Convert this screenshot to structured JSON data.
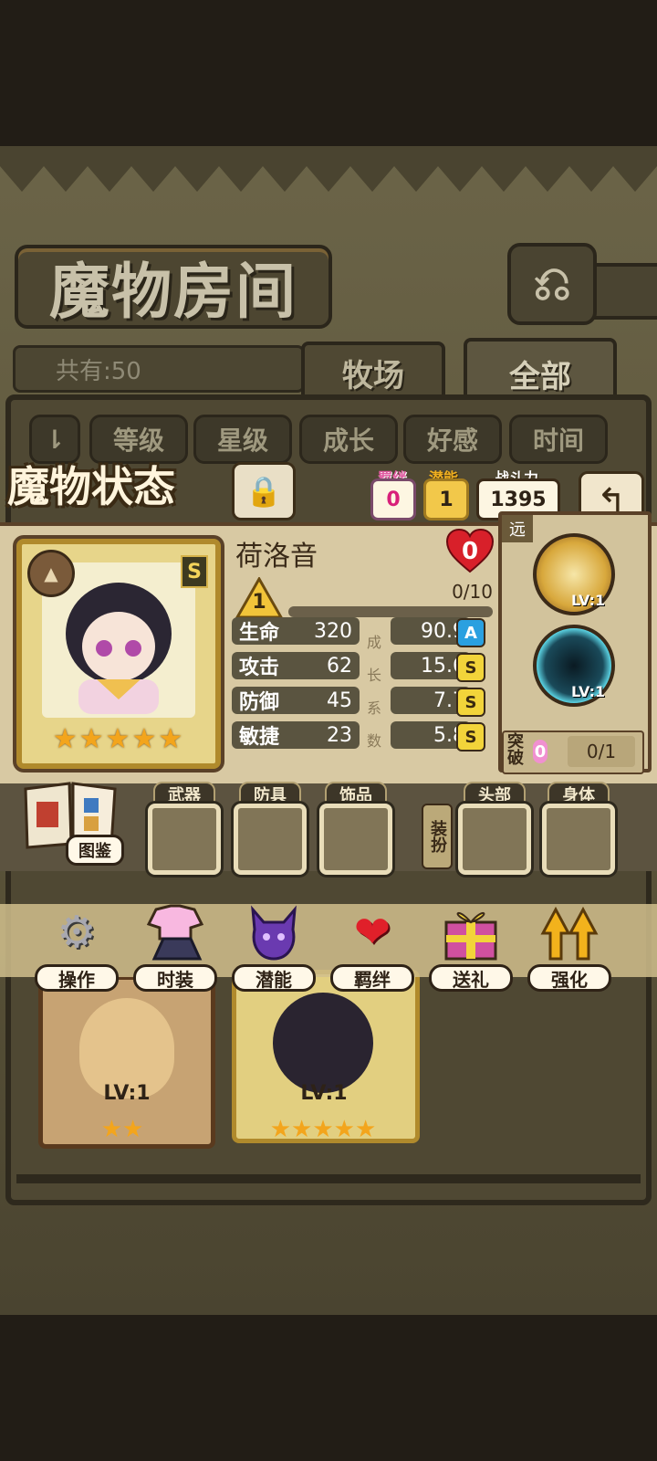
{
  "header": {
    "title": "魔物房间",
    "back_icon": "return-arrow-icon"
  },
  "inventory": {
    "count_label": "共有:50"
  },
  "tabs": [
    {
      "label": "牧场"
    },
    {
      "label": "全部"
    }
  ],
  "sort_buttons": [
    "等级",
    "星级",
    "成长",
    "好感",
    "时间"
  ],
  "status": {
    "title": "魔物状态",
    "bond_label": "羁绊",
    "bond_value": "0",
    "potential_label": "潜能",
    "potential_value": "1",
    "power_label": "战斗力",
    "power_value": "1395"
  },
  "monster": {
    "name": "荷洛音",
    "rank": "S",
    "stars": 5,
    "affection": "0",
    "level": "1",
    "exp_text": "0/10",
    "exp_fraction": 0.0,
    "stats": [
      {
        "name": "生命",
        "value": "320",
        "growth": "90.9",
        "grade": "A"
      },
      {
        "name": "攻击",
        "value": "62",
        "growth": "15.6",
        "grade": "S"
      },
      {
        "name": "防御",
        "value": "45",
        "growth": "7.7",
        "grade": "S"
      },
      {
        "name": "敏捷",
        "value": "23",
        "growth": "5.8",
        "grade": "S"
      }
    ],
    "growth_chars": [
      "成",
      "长",
      "系",
      "数"
    ]
  },
  "skills": {
    "range_tag": "远",
    "items": [
      {
        "lv": "LV:1"
      },
      {
        "lv": "LV:1"
      }
    ],
    "break_label": "突破",
    "break_count": "0",
    "break_progress": "0/1"
  },
  "equipment": {
    "book_label": "图鉴",
    "slots": [
      "武器",
      "防具",
      "饰品",
      "头部",
      "身体"
    ],
    "equip_all": "装扮"
  },
  "actions": [
    {
      "label": "操作",
      "icon": "gear-icon"
    },
    {
      "label": "时装",
      "icon": "outfit-icon"
    },
    {
      "label": "潜能",
      "icon": "demon-icon"
    },
    {
      "label": "羁绊",
      "icon": "hearts-icon"
    },
    {
      "label": "送礼",
      "icon": "gift-icon"
    },
    {
      "label": "强化",
      "icon": "upgrade-arrows-icon"
    }
  ],
  "list": [
    {
      "lv": "LV:1",
      "stars": "★★"
    },
    {
      "lv": "LV:1",
      "stars": "★★★★★"
    }
  ],
  "colors": {
    "accent_gold": "#f3a51c",
    "heart_red": "#d8202a",
    "grade_blue": "#2aa0e0",
    "grade_yellow": "#f2d43a"
  }
}
